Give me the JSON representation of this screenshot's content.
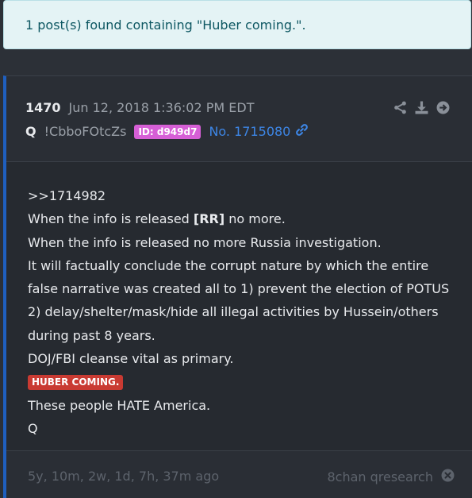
{
  "search_result": {
    "message": "1 post(s) found containing \"Huber coming.\"."
  },
  "post": {
    "number": "1470",
    "timestamp": "Jun 12, 2018 1:36:02 PM EDT",
    "author": "Q",
    "tripcode": "!CbboFOtcZs",
    "id_badge": "ID: d949d7",
    "post_no": "No. 1715080",
    "icons": [
      "share-icon",
      "download-icon",
      "goto-icon",
      "link-icon",
      "close-circle-icon"
    ],
    "body": {
      "reply_ref": ">>1714982",
      "line1_prefix": "When the info is released ",
      "line1_bold": "[RR]",
      "line1_suffix": " no more.",
      "line2": "When the info is released no more Russia investigation.",
      "line3": "It will factually conclude the corrupt nature by which the entire",
      "line4": "false narrative was created all to 1) prevent the election of POTUS",
      "line5": "2) delay/shelter/mask/hide all illegal activities by Hussein/others",
      "line6": "during past 8 years.",
      "line7": "DOJ/FBI cleanse vital as primary.",
      "highlight": "HUBER COMING.",
      "line8": "These people HATE America.",
      "signature": "Q"
    },
    "footer": {
      "age": "5y, 10m, 2w, 1d, 7h, 37m ago",
      "source": "8chan qresearch"
    }
  },
  "colors": {
    "background": "#2c3037",
    "alert_bg": "#e4f3f5",
    "alert_text": "#0d5762",
    "accent_border": "#1f5fbf",
    "id_badge": "#d65fd6",
    "post_link": "#3d86e6",
    "highlight_badge": "#c93a32"
  }
}
